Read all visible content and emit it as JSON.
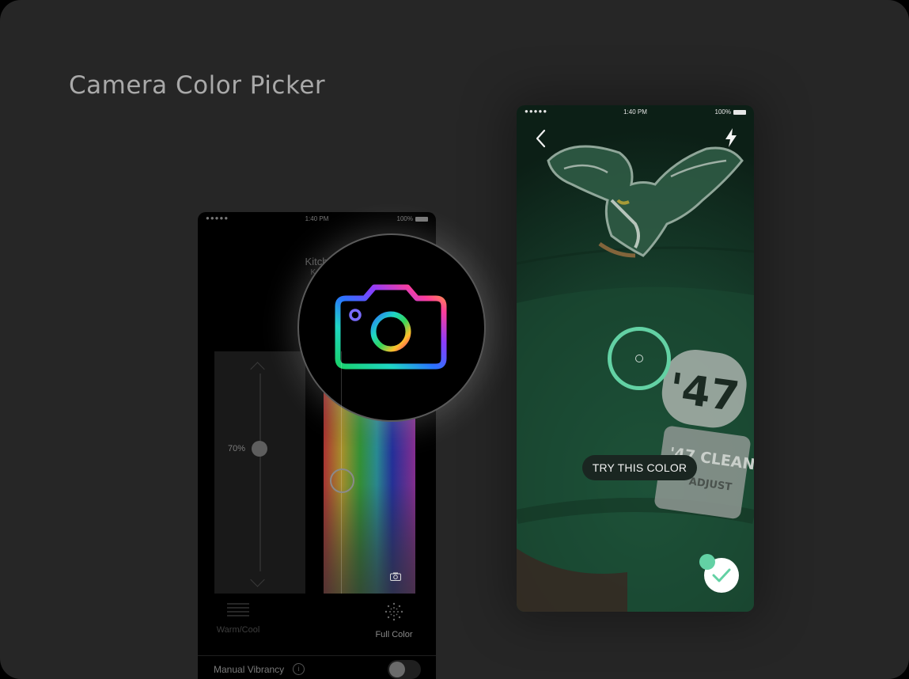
{
  "page": {
    "title": "Camera Color Picker"
  },
  "left_phone": {
    "status_bar": {
      "signal": "●●●●● ",
      "time": "1:40 PM",
      "battery": "100%"
    },
    "room_title": "Kitch",
    "room_subtitle": "Ket",
    "brightness": {
      "label": "70%",
      "value": 0.7
    },
    "modes": [
      {
        "label": "Warm/Cool",
        "icon": "lines-icon",
        "active": false
      },
      {
        "label": "Full Color",
        "icon": "color-wheel-icon",
        "active": true
      }
    ],
    "manual_vibrancy": {
      "label": "Manual Vibrancy",
      "info_icon": "info-icon",
      "enabled": false
    }
  },
  "camera_badge": {
    "icon": "rainbow-camera-icon"
  },
  "right_phone": {
    "status_bar": {
      "signal": "●●●●● ",
      "time": "1:40 PM",
      "battery": "100%"
    },
    "back_icon": "chevron-left-icon",
    "flash_icon": "lightning-icon",
    "try_button": "TRY THIS COLOR",
    "confirm_icon": "checkmark-icon",
    "accent": "#63d1a4",
    "photo_text": {
      "logo_number": "'47",
      "band_text": "'47 CLEAN",
      "strap_text": "ADJUST"
    }
  }
}
